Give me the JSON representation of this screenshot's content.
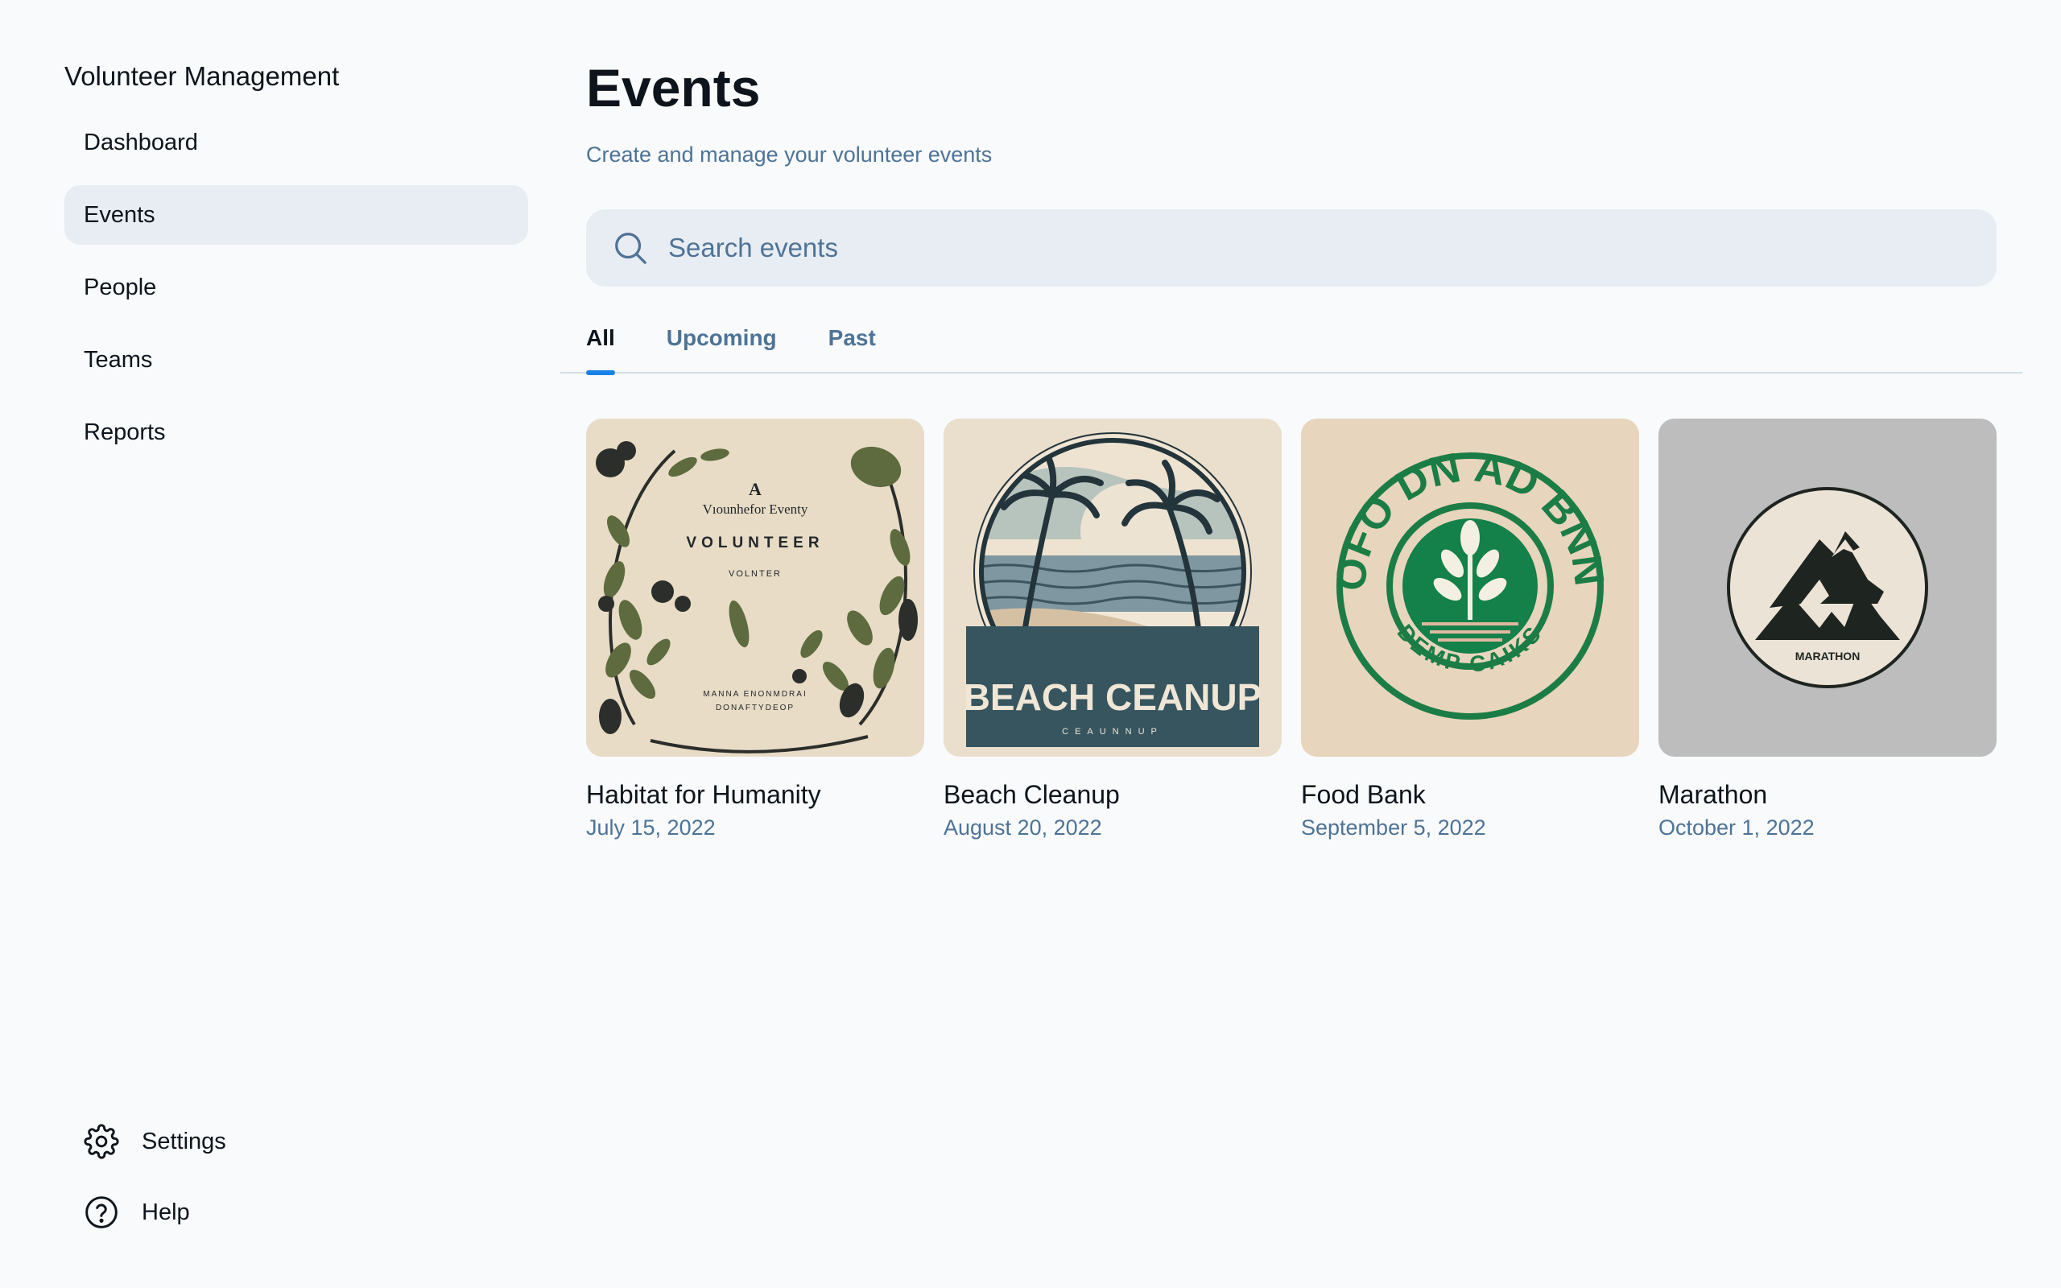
{
  "app": {
    "title": "Volunteer Management"
  },
  "sidebar": {
    "items": [
      {
        "label": "Dashboard",
        "active": false
      },
      {
        "label": "Events",
        "active": true
      },
      {
        "label": "People",
        "active": false
      },
      {
        "label": "Teams",
        "active": false
      },
      {
        "label": "Reports",
        "active": false
      }
    ],
    "bottom": [
      {
        "label": "Settings",
        "icon": "gear-icon"
      },
      {
        "label": "Help",
        "icon": "question-circle-icon"
      }
    ]
  },
  "main": {
    "title": "Events",
    "subtitle": "Create and manage your volunteer events",
    "search": {
      "placeholder": "Search events",
      "value": ""
    },
    "tabs": [
      {
        "label": "All",
        "active": true
      },
      {
        "label": "Upcoming",
        "active": false
      },
      {
        "label": "Past",
        "active": false
      }
    ],
    "events": [
      {
        "name": "Habitat for Humanity",
        "date": "July 15, 2022",
        "image_text": [
          "A",
          "Vıounhefor Eventy",
          "VOLUNTEER",
          "VOLNTER",
          "MANNA ENONMDRAI",
          "DONAFTYDEOP"
        ]
      },
      {
        "name": "Beach Cleanup",
        "date": "August 20, 2022",
        "image_text": [
          "BEACH CEANUP",
          "CEAUNNUP"
        ]
      },
      {
        "name": "Food Bank",
        "date": "September 5, 2022",
        "image_text": [
          "FOFO DN AD BNNR",
          "DEMP CAIKS"
        ]
      },
      {
        "name": "Marathon",
        "date": "October 1, 2022",
        "image_text": [
          "MARATHON"
        ]
      }
    ]
  },
  "colors": {
    "background": "#f8fafc",
    "text": "#0e141b",
    "muted": "#4e7397",
    "surface": "#e8edf3",
    "accent": "#1980e6",
    "divider": "#d0dee7"
  }
}
